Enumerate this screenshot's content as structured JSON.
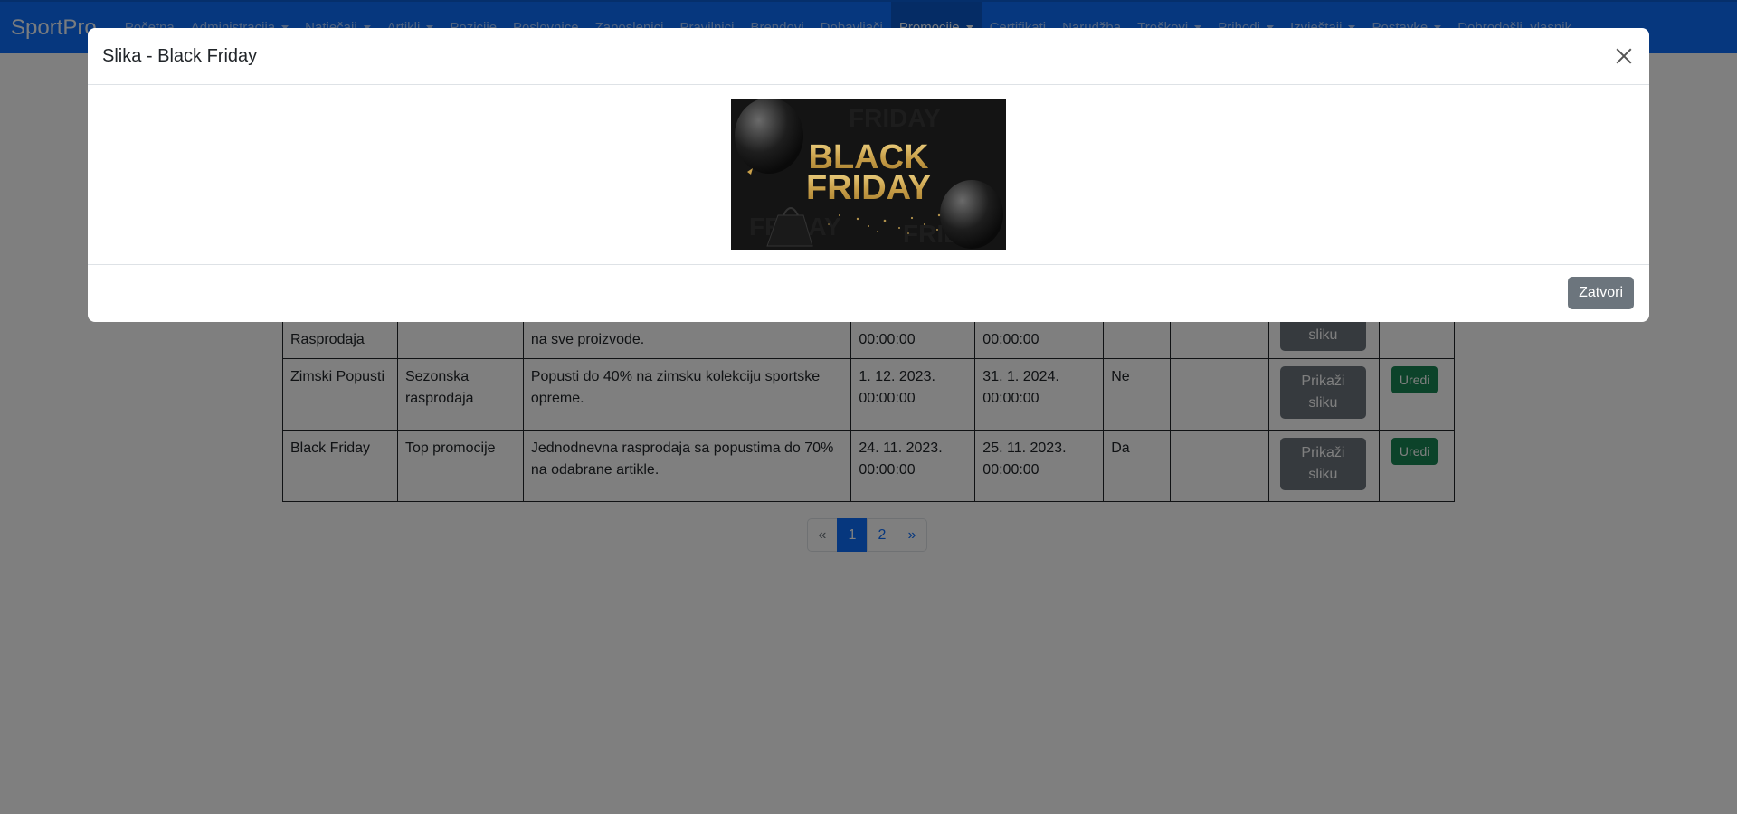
{
  "navbar": {
    "brand": "SportPro",
    "items": [
      {
        "label": "Početna",
        "dropdown": false,
        "active": false
      },
      {
        "label": "Administracija",
        "dropdown": true,
        "active": false
      },
      {
        "label": "Natječaji",
        "dropdown": true,
        "active": false
      },
      {
        "label": "Artikli",
        "dropdown": true,
        "active": false
      },
      {
        "label": "Pozicije",
        "dropdown": false,
        "active": false
      },
      {
        "label": "Poslovnice",
        "dropdown": false,
        "active": false
      },
      {
        "label": "Zaposlenici",
        "dropdown": false,
        "active": false
      },
      {
        "label": "Pravilnici",
        "dropdown": false,
        "active": false
      },
      {
        "label": "Brendovi",
        "dropdown": false,
        "active": false
      },
      {
        "label": "Dobavljači",
        "dropdown": false,
        "active": false
      },
      {
        "label": "Promocije",
        "dropdown": true,
        "active": true
      },
      {
        "label": "Certifikati",
        "dropdown": false,
        "active": false
      },
      {
        "label": "Narudžba",
        "dropdown": false,
        "active": false
      },
      {
        "label": "Troškovi",
        "dropdown": true,
        "active": false
      },
      {
        "label": "Prihodi",
        "dropdown": true,
        "active": false
      },
      {
        "label": "Izvještaji",
        "dropdown": true,
        "active": false
      },
      {
        "label": "Postavke",
        "dropdown": true,
        "active": false
      },
      {
        "label": "Dobrodošli, vlasnik",
        "dropdown": false,
        "active": false
      }
    ]
  },
  "table": {
    "rows": [
      {
        "naziv": "Rasprodaja",
        "kategorija": "",
        "opis": "na sve proizvode.",
        "pocetak": "00:00:00",
        "kraj": "00:00:00",
        "aktivno": "",
        "extra": "",
        "slika_btn": "sliku",
        "uredi_btn": ""
      },
      {
        "naziv": "Zimski Popusti",
        "kategorija": "Sezonska rasprodaja",
        "opis": "Popusti do 40% na zimsku kolekciju sportske opreme.",
        "pocetak": "1. 12. 2023. 00:00:00",
        "kraj": "31. 1. 2024. 00:00:00",
        "aktivno": "Ne",
        "extra": "",
        "slika_btn": "Prikaži sliku",
        "uredi_btn": "Uredi"
      },
      {
        "naziv": "Black Friday",
        "kategorija": "Top promocije",
        "opis": "Jednodnevna rasprodaja sa popustima do 70% na odabrane artikle.",
        "pocetak": "24. 11. 2023. 00:00:00",
        "kraj": "25. 11. 2023. 00:00:00",
        "aktivno": "Da",
        "extra": "",
        "slika_btn": "Prikaži sliku",
        "uredi_btn": "Uredi"
      }
    ]
  },
  "pagination": {
    "prev": "«",
    "pages": [
      "1",
      "2"
    ],
    "current": "1",
    "next": "»"
  },
  "modal": {
    "title": "Slika - Black Friday",
    "image_text_line1": "BLACK",
    "image_text_line2": "FRIDAY",
    "close_button": "Zatvori"
  },
  "colors": {
    "navbar": "#0d6efd",
    "active_nav": "#0a58ca",
    "secondary_button": "#6c757d",
    "success_button": "#198754",
    "gold": "#d9b25a"
  }
}
